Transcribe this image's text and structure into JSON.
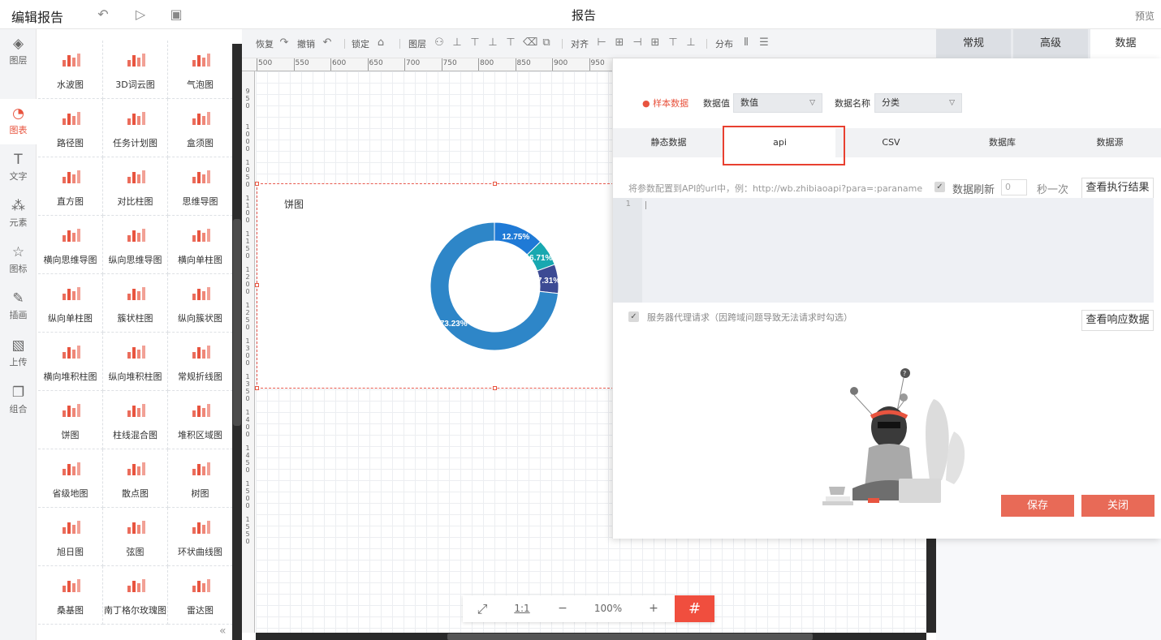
{
  "topbar": {
    "title": "编辑报告",
    "doc_title": "报告",
    "preview": "预览"
  },
  "leftnav": [
    {
      "label": "图层",
      "icon": "layers-icon"
    },
    {
      "label": "图表",
      "icon": "pie-chart-icon"
    },
    {
      "label": "文字",
      "icon": "text-icon"
    },
    {
      "label": "元素",
      "icon": "shapes-icon"
    },
    {
      "label": "图标",
      "icon": "star-icon"
    },
    {
      "label": "插画",
      "icon": "palette-icon"
    },
    {
      "label": "上传",
      "icon": "upload-image-icon"
    },
    {
      "label": "组合",
      "icon": "group-icon"
    }
  ],
  "components": [
    {
      "label": "水波图",
      "icon": "water-wave-icon"
    },
    {
      "label": "3D词云图",
      "icon": "word-cloud-icon"
    },
    {
      "label": "气泡图",
      "icon": "bubble-icon"
    },
    {
      "label": "路径图",
      "icon": "path-icon"
    },
    {
      "label": "任务计划图",
      "icon": "gantt-icon"
    },
    {
      "label": "盒须图",
      "icon": "boxplot-icon"
    },
    {
      "label": "直方图",
      "icon": "histogram-icon"
    },
    {
      "label": "对比柱图",
      "icon": "compare-bar-icon"
    },
    {
      "label": "思维导图",
      "icon": "mindmap-icon"
    },
    {
      "label": "横向思维导图",
      "icon": "h-mindmap-icon"
    },
    {
      "label": "纵向思维导图",
      "icon": "v-mindmap-icon"
    },
    {
      "label": "横向单柱图",
      "icon": "h-bar-icon"
    },
    {
      "label": "纵向单柱图",
      "icon": "v-bar-icon"
    },
    {
      "label": "簇状柱图",
      "icon": "cluster-bar-icon"
    },
    {
      "label": "纵向簇状图",
      "icon": "v-cluster-icon"
    },
    {
      "label": "横向堆积柱图",
      "icon": "h-stack-icon"
    },
    {
      "label": "纵向堆积柱图",
      "icon": "v-stack-icon"
    },
    {
      "label": "常规折线图",
      "icon": "line-icon"
    },
    {
      "label": "饼图",
      "icon": "pie-icon"
    },
    {
      "label": "柱线混合图",
      "icon": "bar-line-icon"
    },
    {
      "label": "堆积区域图",
      "icon": "area-icon"
    },
    {
      "label": "省级地图",
      "icon": "map-icon"
    },
    {
      "label": "散点图",
      "icon": "scatter-icon"
    },
    {
      "label": "树图",
      "icon": "tree-icon"
    },
    {
      "label": "旭日图",
      "icon": "sunburst-icon"
    },
    {
      "label": "弦图",
      "icon": "chord-icon"
    },
    {
      "label": "环状曲线图",
      "icon": "ring-curve-icon"
    },
    {
      "label": "桑基图",
      "icon": "sankey-icon"
    },
    {
      "label": "南丁格尔玫瑰图",
      "icon": "rose-icon"
    },
    {
      "label": "雷达图",
      "icon": "radar-icon"
    }
  ],
  "toolbar": {
    "redo": "恢复",
    "undo": "撤销",
    "lock": "锁定",
    "layer": "图层",
    "align": "对齐",
    "distribute": "分布"
  },
  "ruler": {
    "h": [
      "500",
      "550",
      "600",
      "650",
      "700",
      "750",
      "800",
      "850",
      "900",
      "950"
    ],
    "v": [
      "950",
      "1000",
      "1050",
      "1100",
      "1150",
      "1200",
      "1250",
      "1300",
      "1350",
      "1400",
      "1450",
      "1500",
      "1550"
    ]
  },
  "chart": {
    "title": "饼图"
  },
  "chart_data": {
    "type": "pie",
    "title": "饼图",
    "donut": true,
    "slices": [
      {
        "label": "12.75%",
        "value": 12.75,
        "color": "#1f7ad6"
      },
      {
        "label": "6.71%",
        "value": 6.71,
        "color": "#18a8b0"
      },
      {
        "label": "7.31%",
        "value": 7.31,
        "color": "#3c4a94"
      },
      {
        "label": "73.23%",
        "value": 73.23,
        "color": "#2e86c8"
      }
    ]
  },
  "zoom": {
    "fit": "⤢",
    "one_to_one": "1:1",
    "minus": "−",
    "level": "100%",
    "plus": "+",
    "grid": "#"
  },
  "right_tabs": [
    {
      "label": "常规"
    },
    {
      "label": "高级"
    },
    {
      "label": "数据"
    }
  ],
  "modal": {
    "sample_label": "● 样本数据",
    "value_label": "数据值",
    "value_select": "数值",
    "name_label": "数据名称",
    "name_select": "分类",
    "tabs": [
      {
        "label": "静态数据"
      },
      {
        "label": "api"
      },
      {
        "label": "CSV"
      },
      {
        "label": "数据库"
      },
      {
        "label": "数据源"
      }
    ],
    "api_hint": "将参数配置到API的url中，例：http://wb.zhibiaoapi?para=:paraname",
    "refresh_label": "数据刷新",
    "refresh_value": "0",
    "refresh_unit": "秒一次",
    "exec_button": "查看执行结果",
    "line_no": "1",
    "proxy_label": "服务器代理请求（因跨域问题导致无法请求时勾选）",
    "response_button": "查看响应数据",
    "save": "保存",
    "close": "关闭"
  }
}
